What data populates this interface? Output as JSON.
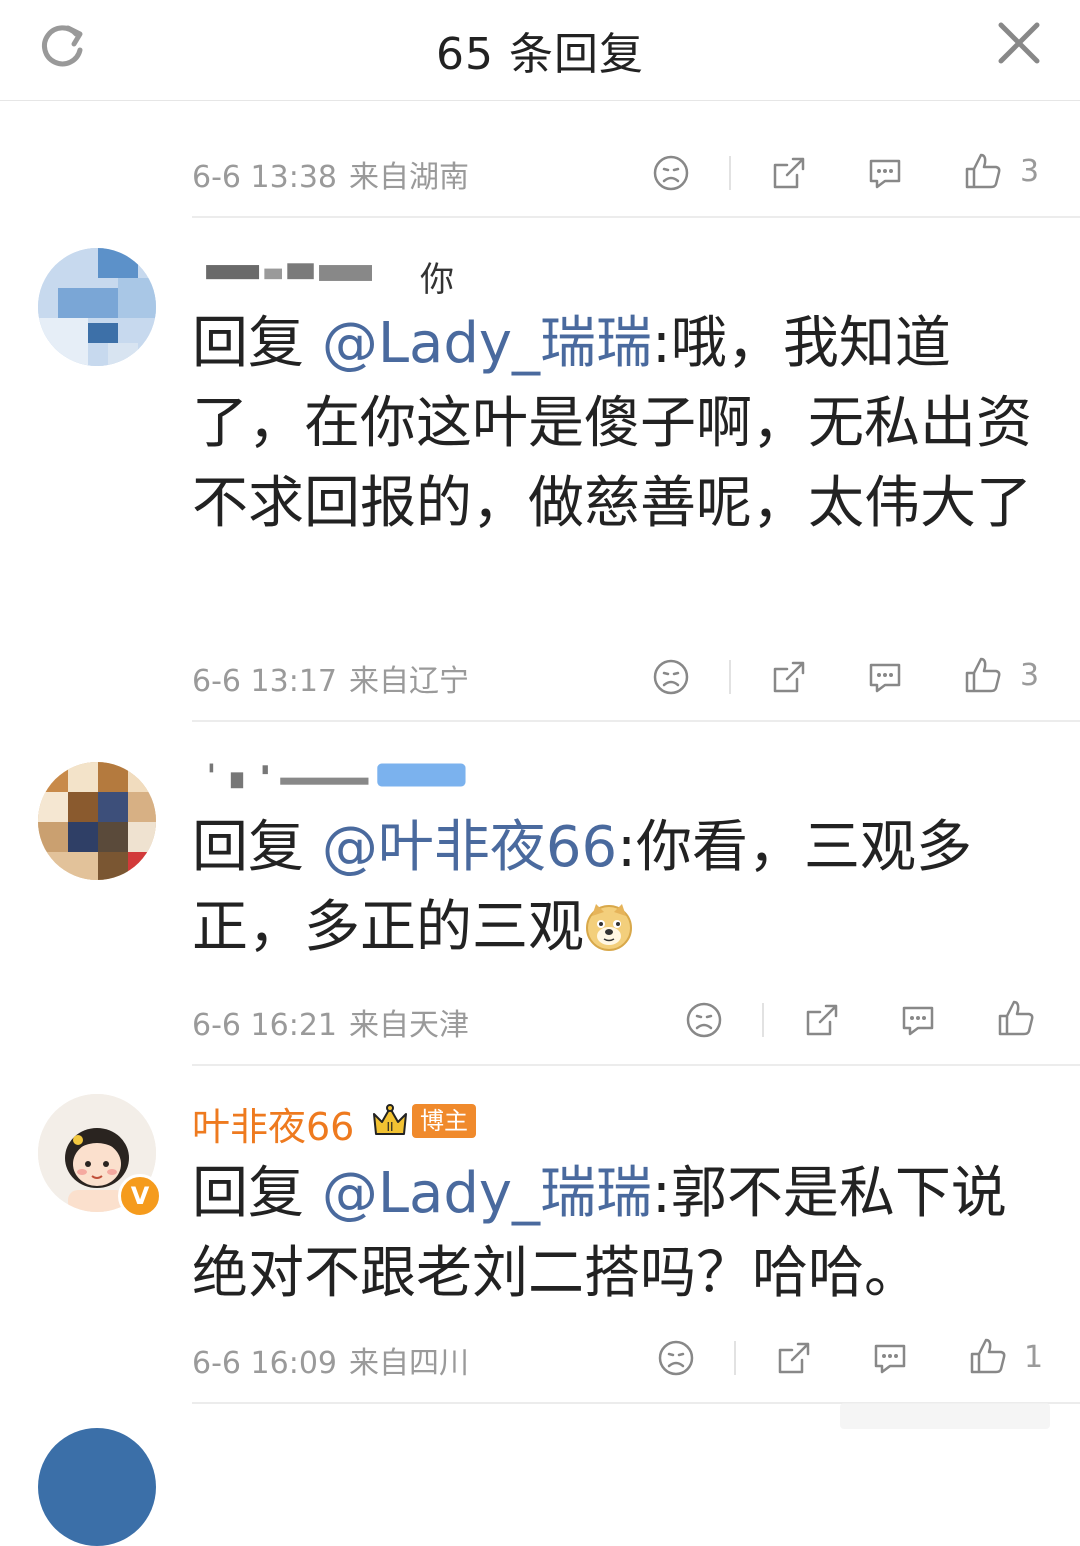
{
  "header": {
    "title": "65 条回复",
    "refresh_icon": "refresh-icon",
    "close_icon": "close-icon"
  },
  "colors": {
    "mention": "#4a6a9e",
    "blogger_name": "#ee7a1f",
    "meta": "#9a9a9a"
  },
  "comments": [
    {
      "time": "6-6 13:38",
      "location": "来自湖南",
      "likes": "3"
    },
    {
      "username_visible": "你",
      "reply_prefix": "回复",
      "mention": "@Lady_瑞瑞",
      "text": ":哦，我知道了，在你这叶是傻子啊，无私出资不求回报的，做慈善呢，太伟大了",
      "time": "6-6 13:17",
      "location": "来自辽宁",
      "likes": "3"
    },
    {
      "reply_prefix": "回复",
      "mention": "@叶非夜66",
      "text": ":你看，三观多正，多正的三观",
      "emoji": "doge-emoji",
      "time": "6-6 16:21",
      "location": "来自天津",
      "likes": ""
    },
    {
      "username": "叶非夜66",
      "badge": "博主",
      "reply_prefix": "回复",
      "mention": "@Lady_瑞瑞",
      "text": ":郭不是私下说绝对不跟老刘二搭吗？哈哈。",
      "verified": "V",
      "time": "6-6 16:09",
      "location": "来自四川",
      "likes": "1"
    }
  ]
}
